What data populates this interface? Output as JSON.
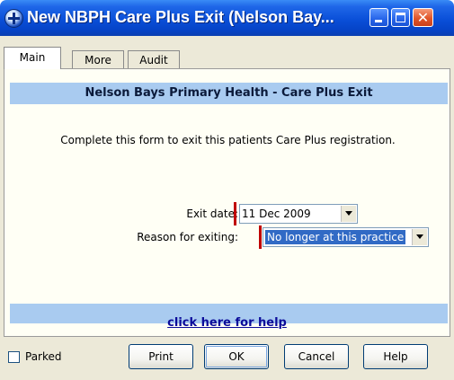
{
  "window": {
    "title": "New NBPH Care Plus Exit (Nelson Bay...",
    "minimize_icon": "minimize-icon",
    "maximize_icon": "maximize-icon",
    "close_icon": "close-icon",
    "close_glyph": "✕"
  },
  "tabs": [
    {
      "label": "Main",
      "active": true
    },
    {
      "label": "More",
      "active": false
    },
    {
      "label": "Audit",
      "active": false
    }
  ],
  "form": {
    "header": "Nelson Bays Primary Health - Care Plus Exit",
    "intro": "Complete this form to exit this patients Care Plus registration.",
    "exit_date_label": "Exit date:",
    "exit_date_value": "11 Dec 2009",
    "reason_label": "Reason for exiting:",
    "reason_value": "No longer at this practice",
    "help_link": "click here for help"
  },
  "footer": {
    "parked_label": "Parked",
    "parked_checked": false,
    "print_label": "Print",
    "ok_label": "OK",
    "cancel_label": "Cancel",
    "help_label": "Help"
  },
  "colors": {
    "title_bar": "#0a4fd8",
    "header_band": "#a9cbf0",
    "required_marker": "#c00000",
    "selection": "#316ac5",
    "link": "#0b0b9a"
  }
}
